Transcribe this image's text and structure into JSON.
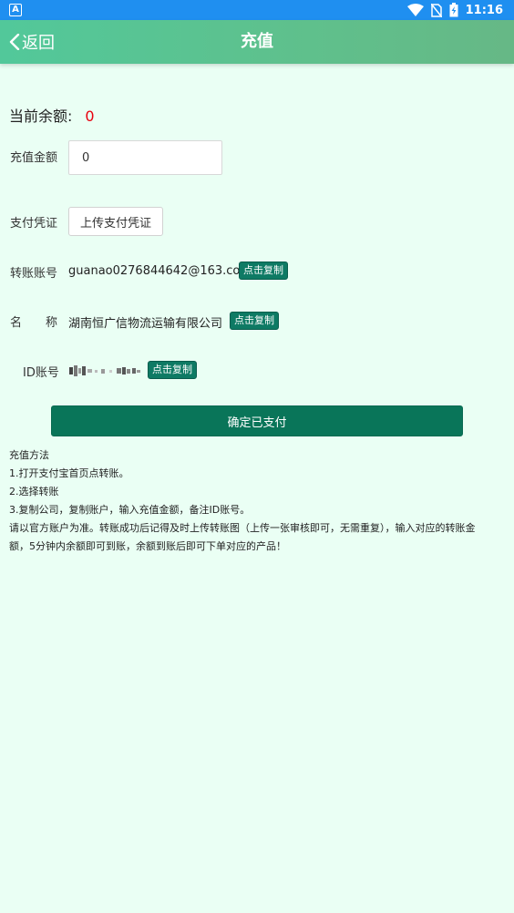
{
  "status_bar": {
    "app_icon_letter": "A",
    "time": "11:16",
    "icons": [
      "wifi-icon",
      "no-sim-icon",
      "battery-charging-icon"
    ]
  },
  "header": {
    "back_label": "返回",
    "title": "充值"
  },
  "balance": {
    "label": "当前余额:",
    "value": "0",
    "value_color": "#e8000d"
  },
  "recharge_amount": {
    "label": "充值金额",
    "value": "0"
  },
  "payment_proof": {
    "label": "支付凭证",
    "button_label": "上传支付凭证"
  },
  "transfer_account": {
    "label": "转账账号",
    "value": "guanao0276844642@163.com",
    "copy_label": "点击复制"
  },
  "account_name": {
    "label": "名　　称",
    "value": "湖南恒广信物流运输有限公司",
    "copy_label": "点击复制"
  },
  "user_id": {
    "label": "ID账号",
    "copy_label": "点击复制"
  },
  "confirm_button": "确定已支付",
  "instructions": {
    "title": "充值方法",
    "lines": [
      "1.打开支付宝首页点转账。",
      "2.选择转账",
      "3.复制公司，复制账户，输入充值金额，备注ID账号。",
      "请以官方账户为准。转账成功后记得及时上传转账图（上传一张审核即可，无需重复），输入对应的转账金",
      "额，5分钟内余额即可到账，余额到账后即可下单对应的产品！"
    ]
  },
  "colors": {
    "page_bg": "#eafff4",
    "header_green": "#5fc08c",
    "button_dark_green": "#097559",
    "status_bar_blue": "#1f8ff0"
  }
}
